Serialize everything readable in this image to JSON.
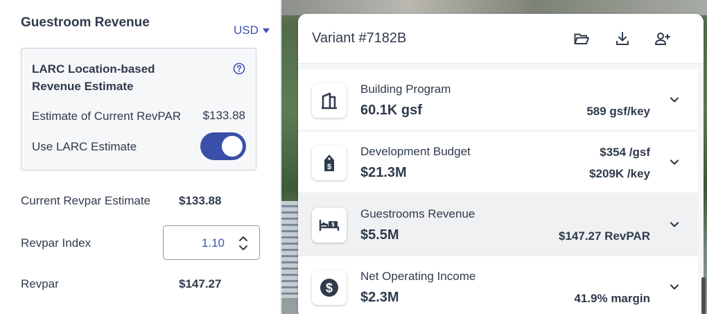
{
  "guestroom": {
    "title": "Guestroom Revenue",
    "currency": "USD"
  },
  "larc": {
    "title": "LARC Location-based Revenue Estimate",
    "estimate_label": "Estimate of Current RevPAR",
    "estimate_value": "$133.88",
    "use_label": "Use LARC Estimate",
    "use_enabled": true
  },
  "revpar": {
    "current_label": "Current Revpar Estimate",
    "current_value": "$133.88",
    "index_label": "Revpar Index",
    "index_value": "1.10",
    "revpar_label": "Revpar",
    "revpar_value": "$147.27"
  },
  "variant": {
    "title": "Variant #7182B",
    "icons": [
      "folder-open-icon",
      "download-icon",
      "add-user-icon"
    ]
  },
  "metrics": [
    {
      "label": "Building Program",
      "value": "60.1K gsf",
      "right_top": "",
      "right_bottom": "589 gsf/key",
      "icon": "building-icon"
    },
    {
      "label": "Development Budget",
      "value": "$21.3M",
      "right_top": "$354 /gsf",
      "right_bottom": "$209K /key",
      "icon": "price-tag-icon"
    },
    {
      "label": "Guestrooms Revenue",
      "value": "$5.5M",
      "right_top": "",
      "right_bottom": "$147.27 RevPAR",
      "icon": "bed-dollar-icon"
    },
    {
      "label": "Net Operating Income",
      "value": "$2.3M",
      "right_top": "",
      "right_bottom": "41.9% margin",
      "icon": "dollar-coin-icon"
    }
  ],
  "colors": {
    "accent": "#3a52b4",
    "toggle": "#3a4fa8",
    "text": "#2f3b4c"
  }
}
